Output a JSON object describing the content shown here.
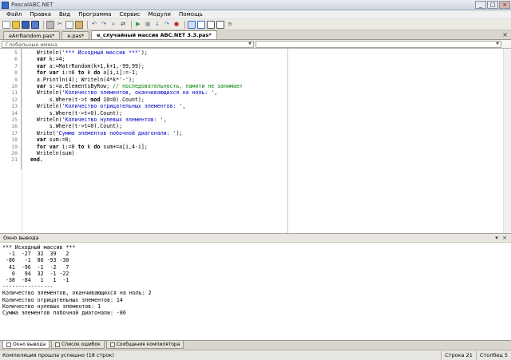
{
  "window": {
    "title": "PascalABC.NET"
  },
  "menu": [
    "Файл",
    "Правка",
    "Вид",
    "Программа",
    "Сервис",
    "Модули",
    "Помощь"
  ],
  "toolbar": {
    "icons": [
      "new-file-icon",
      "open-folder-icon",
      "save-icon",
      "save-all-icon",
      "print-icon",
      "cut-icon",
      "copy-icon",
      "paste-icon",
      "undo-icon",
      "redo-icon",
      "find-icon",
      "replace-icon",
      "run-icon",
      "stop-icon",
      "step-into-icon",
      "step-over-icon",
      "breakpoint-icon",
      "layout-icon",
      "window-icon",
      "split-icon",
      "panel-icon",
      "format-icon"
    ]
  },
  "tabs": [
    {
      "label": "eArrRandom.pas*",
      "active": false
    },
    {
      "label": "e.pas*",
      "active": false
    },
    {
      "label": "e_случайный массив ABC.NET 3.3.pas*",
      "active": true
    }
  ],
  "nav": {
    "scope": "Глобальные имена",
    "member": ""
  },
  "editor": {
    "line_numbers": [
      "5",
      "6",
      "7",
      "8",
      "9",
      "10",
      "11",
      "12",
      "13",
      "14",
      "15",
      "16",
      "17",
      "18",
      "19",
      "20",
      "21"
    ],
    "lines": [
      [
        {
          "t": "    Writeln(",
          "c": ""
        },
        {
          "t": "'*** Исходный массив ***'",
          "c": "str"
        },
        {
          "t": ");",
          "c": ""
        }
      ],
      [
        {
          "t": "    var ",
          "c": "kw"
        },
        {
          "t": "k:=4;",
          "c": ""
        }
      ],
      [
        {
          "t": "    var ",
          "c": "kw"
        },
        {
          "t": "a:=MatrRandom(k+1,k+1,-99,99);",
          "c": ""
        }
      ],
      [
        {
          "t": "    for var ",
          "c": "kw"
        },
        {
          "t": "i:=0 ",
          "c": ""
        },
        {
          "t": "to ",
          "c": "kw"
        },
        {
          "t": "k ",
          "c": ""
        },
        {
          "t": "do ",
          "c": "kw"
        },
        {
          "t": "a[i,i]:=-1;",
          "c": ""
        }
      ],
      [
        {
          "t": "    a.Println(4); Writeln(4*k*'-');",
          "c": ""
        }
      ],
      [
        {
          "t": "    var ",
          "c": "kw"
        },
        {
          "t": "s:=a.ElementsByRow; ",
          "c": ""
        },
        {
          "t": "// последовательность, памяти не занимает",
          "c": "cmt"
        }
      ],
      [
        {
          "t": "    Writeln(",
          "c": ""
        },
        {
          "t": "'Количество элементов, оканчивающихся на ноль: '",
          "c": "str"
        },
        {
          "t": ",",
          "c": ""
        }
      ],
      [
        {
          "t": "        s.Where(t->t ",
          "c": ""
        },
        {
          "t": "mod ",
          "c": "kw"
        },
        {
          "t": "10=0).Count);",
          "c": ""
        }
      ],
      [
        {
          "t": "    Writeln(",
          "c": ""
        },
        {
          "t": "'Количество отрицательных элементов: '",
          "c": "str"
        },
        {
          "t": ",",
          "c": ""
        }
      ],
      [
        {
          "t": "        s.Where(t->t<0).Count);",
          "c": ""
        }
      ],
      [
        {
          "t": "    Writeln(",
          "c": ""
        },
        {
          "t": "'Количество нулевых элементов: '",
          "c": "str"
        },
        {
          "t": ",",
          "c": ""
        }
      ],
      [
        {
          "t": "        s.Where(t->t=0).Count);",
          "c": ""
        }
      ],
      [
        {
          "t": "    Write(",
          "c": ""
        },
        {
          "t": "'Сумма элементов побочной диагонали: '",
          "c": "str"
        },
        {
          "t": ");",
          "c": ""
        }
      ],
      [
        {
          "t": "    var ",
          "c": "kw"
        },
        {
          "t": "sum:=0;",
          "c": ""
        }
      ],
      [
        {
          "t": "    for var ",
          "c": "kw"
        },
        {
          "t": "i:=0 ",
          "c": ""
        },
        {
          "t": "to ",
          "c": "kw"
        },
        {
          "t": "k ",
          "c": ""
        },
        {
          "t": "do ",
          "c": "kw"
        },
        {
          "t": "sum+=a[i,4-i];",
          "c": ""
        }
      ],
      [
        {
          "t": "    Writeln(sum)",
          "c": ""
        }
      ],
      [
        {
          "t": "  end.",
          "c": "kw"
        }
      ]
    ]
  },
  "output": {
    "title": "Окно вывода",
    "lines": [
      "*** Исходный массив ***",
      "  -1  -27  32  39   2",
      " -86   -1  86 -93 -30",
      "  41  -96  -1  -2   7",
      "   0   94  32  -1 -22",
      " -38  -84   1   1  -1",
      "----------------",
      "Количество элементов, оканчивающихся на ноль: 2",
      "Количество отрицательных элементов: 14",
      "Количество нулевых элементов: 1",
      "Сумма элементов побочной диагонали: -86"
    ]
  },
  "bottom_tabs": [
    "Окно вывода",
    "Список ошибок",
    "Сообщения компилятора"
  ],
  "status": {
    "message": "Компиляция прошла успешно (18 строк)",
    "row_label": "Строка",
    "row": "21",
    "col_label": "Столбец",
    "col": "5"
  }
}
